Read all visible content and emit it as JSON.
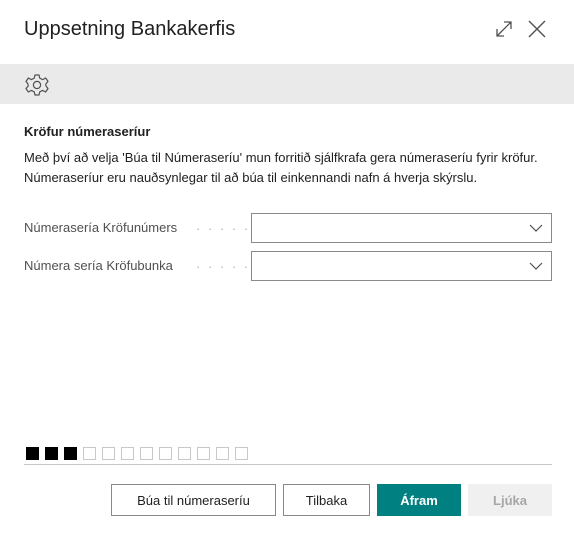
{
  "dialog": {
    "title": "Uppsetning Bankakerfis",
    "icons": {
      "expand": "expand-icon",
      "close": "close-icon",
      "settings": "gear-icon"
    }
  },
  "section": {
    "title": "Kröfur númeraseríur",
    "description": "Með því að velja 'Búa til Númeraseríu' mun forritið sjálfkrafa gera númeraseríu fyrir kröfur. Númeraseríur eru nauðsynlegar til að búa til einkennandi nafn á hverja skýrslu."
  },
  "fields": [
    {
      "label": "Númerasería Kröfunúmers",
      "value": ""
    },
    {
      "label": "Númera sería Kröfubunka",
      "value": ""
    }
  ],
  "progress": {
    "current_step": 3,
    "total_steps": 12
  },
  "buttons": {
    "create": "Búa til númeraseríu",
    "back": "Tilbaka",
    "next": "Áfram",
    "finish": "Ljúka"
  },
  "colors": {
    "accent": "#008080",
    "action_bar": "#eaeaea",
    "disabled": "#f0f0f0"
  }
}
